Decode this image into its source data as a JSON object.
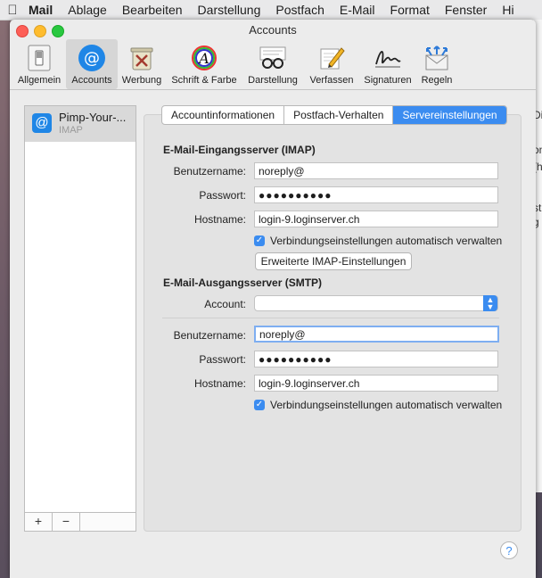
{
  "menubar": {
    "app": "Mail",
    "items": [
      "Ablage",
      "Bearbeiten",
      "Darstellung",
      "Postfach",
      "E-Mail",
      "Format",
      "Fenster",
      "Hi"
    ]
  },
  "background_text": [
    "Di",
    "on",
    "(h",
    "st",
    "g l"
  ],
  "window": {
    "title": "Accounts"
  },
  "toolbar": {
    "items": [
      {
        "label": "Allgemein",
        "icon": "switch-icon"
      },
      {
        "label": "Accounts",
        "icon": "at-sign-icon",
        "selected": true
      },
      {
        "label": "Werbung",
        "icon": "junk-mail-icon"
      },
      {
        "label": "Schrift & Farbe",
        "icon": "font-color-icon"
      },
      {
        "label": "Darstellung",
        "icon": "glasses-icon"
      },
      {
        "label": "Verfassen",
        "icon": "compose-icon"
      },
      {
        "label": "Signaturen",
        "icon": "signature-icon"
      },
      {
        "label": "Regeln",
        "icon": "rules-envelope-icon"
      }
    ]
  },
  "sidebar": {
    "account": {
      "name": "Pimp-Your-...",
      "type": "IMAP"
    },
    "add_label": "+",
    "remove_label": "−"
  },
  "tabs": [
    "Accountinformationen",
    "Postfach-Verhalten",
    "Servereinstellungen"
  ],
  "active_tab": "Servereinstellungen",
  "imap": {
    "heading": "E-Mail-Eingangsserver (IMAP)",
    "user_label": "Benutzername:",
    "user_value": "noreply@",
    "pass_label": "Passwort:",
    "pass_value": "●●●●●●●●●●",
    "host_label": "Hostname:",
    "host_value": "login-9.loginserver.ch",
    "auto_label": "Verbindungseinstellungen automatisch verwalten",
    "auto_checked": true,
    "advanced_button": "Erweiterte IMAP-Einstellungen"
  },
  "smtp": {
    "heading": "E-Mail-Ausgangsserver (SMTP)",
    "account_label": "Account:",
    "account_value": "",
    "user_label": "Benutzername:",
    "user_value": "noreply@",
    "pass_label": "Passwort:",
    "pass_value": "●●●●●●●●●●",
    "host_label": "Hostname:",
    "host_value": "login-9.loginserver.ch",
    "auto_label": "Verbindungseinstellungen automatisch verwalten",
    "auto_checked": true
  },
  "help_label": "?",
  "colors": {
    "accent": "#3b8cf0",
    "close": "#fd5f57",
    "minimize": "#febc2e",
    "zoom": "#29c840"
  }
}
